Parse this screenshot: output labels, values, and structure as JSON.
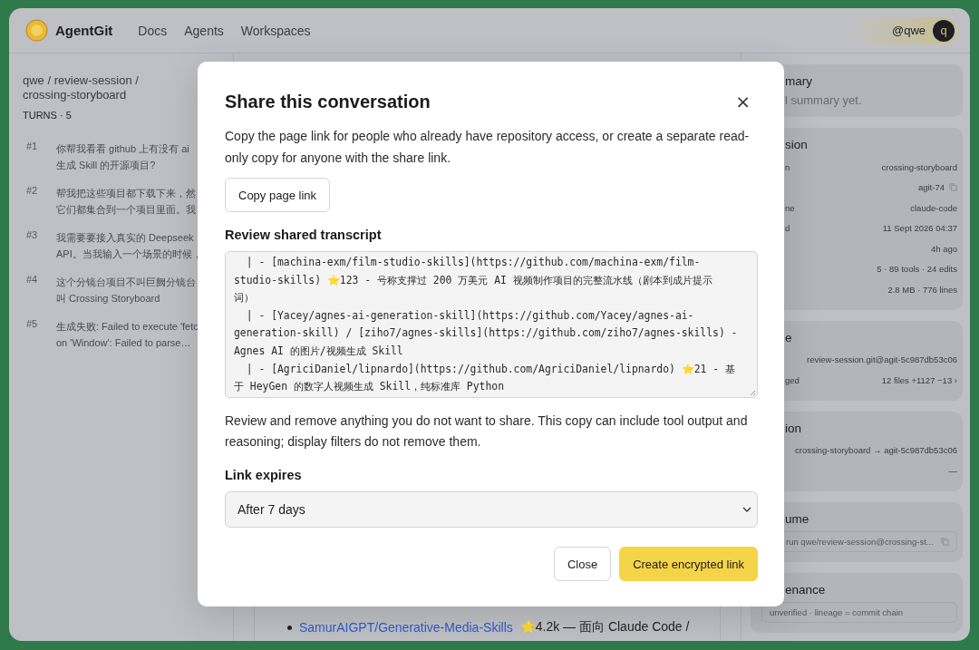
{
  "header": {
    "brand": "AgentGit",
    "nav": [
      {
        "label": "Docs"
      },
      {
        "label": "Agents"
      },
      {
        "label": "Workspaces"
      }
    ],
    "user": {
      "handle": "@qwe",
      "avatar": "q"
    }
  },
  "sidebar": {
    "title": "qwe / review-session / crossing-storyboard",
    "count": "TURNS · 5",
    "turns": [
      {
        "number": "#1",
        "lines": [
          "你帮我看看 github 上有没有 ai",
          "生成 Skill 的开源项目?"
        ]
      },
      {
        "number": "#2",
        "lines": [
          "帮我把这些项目都下载下来，然",
          "它们都集合到一个项目里面。我"
        ]
      },
      {
        "number": "#3",
        "lines": [
          "我需要要接入真实的 Deepseek",
          "API。当我输入一个场景的时候，"
        ]
      },
      {
        "number": "#4",
        "lines": [
          "这个分镜台项目不叫巨阙分镜台",
          "叫 Crossing Storyboard"
        ]
      },
      {
        "number": "#5",
        "lines": [
          "生成失败: Failed to execute 'fetc",
          "on 'Window': Failed to parse…"
        ]
      }
    ]
  },
  "content": {
    "bullet_link": "SamurAIGPT/Generative-Media-Skills",
    "bullet_text": "⭐4.2k — 面向 Claude Code /"
  },
  "panels": [
    {
      "title": "mary",
      "note": "l summary yet."
    },
    {
      "title": "sion",
      "rows": [
        {
          "label": "n",
          "value": "crossing-storyboard"
        },
        {
          "value": "agit-74",
          "copy": true
        },
        {
          "label": "ne",
          "value": "claude-code"
        },
        {
          "label": "d",
          "value": "11 Sept 2026 04:37"
        },
        {
          "value": "4h ago"
        },
        {
          "value": "5 · 89 tools · 24 edits"
        },
        {
          "value": "2.8 MB · 776 lines"
        }
      ]
    },
    {
      "title": "e",
      "rows": [
        {
          "value": "review-session.git@agit-5c987db53c06"
        },
        {
          "label": "ged",
          "value": "12 files +1127 −13 ›"
        }
      ]
    },
    {
      "title": "ion",
      "rows": [
        {
          "value": "crossing-storyboard → agit-5c987db53c06"
        },
        {
          "value": "—"
        }
      ]
    },
    {
      "title": "ume",
      "field": "run qwe/review-session@crossing-st...",
      "copy": true
    },
    {
      "title": "enance",
      "field": "unverified · lineage = commit chain"
    }
  ],
  "dialog": {
    "title": "Share this conversation",
    "close": "×",
    "intro": "Copy the page link for people who already have repository access, or create a separate read-only copy for anyone with the share link.",
    "copy_button": "Copy page link",
    "transcript_label": "Review shared transcript",
    "transcript": [
      "  | - [machina-exm/film-studio-skills](https://github.com/machina-exm/film-",
      "studio-skills) ⭐123 - 号称支撑过 200 万美元 AI 视频制作项目的完整流水线（剧本到成片提示",
      "词）",
      "  | - [Yacey/agnes-ai-generation-skill](https://github.com/Yacey/agnes-ai-",
      "generation-skill) / [ziho7/agnes-skills](https://github.com/ziho7/agnes-skills) -",
      "Agnes AI 的图片/视频生成 Skill",
      "  | - [AgriciDaniel/lipnardo](https://github.com/AgriciDaniel/lipnardo) ⭐21 - 基",
      "于 HeyGen 的数字人视频生成 Skill，纯标准库 Python"
    ],
    "warning": "Review and remove anything you do not want to share. This copy can include tool output and reasoning; display filters do not remove them.",
    "expires_label": "Link expires",
    "expires_value": "After 7 days",
    "buttons": [
      {
        "label": "Close",
        "kind": "secondary"
      },
      {
        "label": "Create encrypted link",
        "kind": "primary"
      }
    ]
  }
}
